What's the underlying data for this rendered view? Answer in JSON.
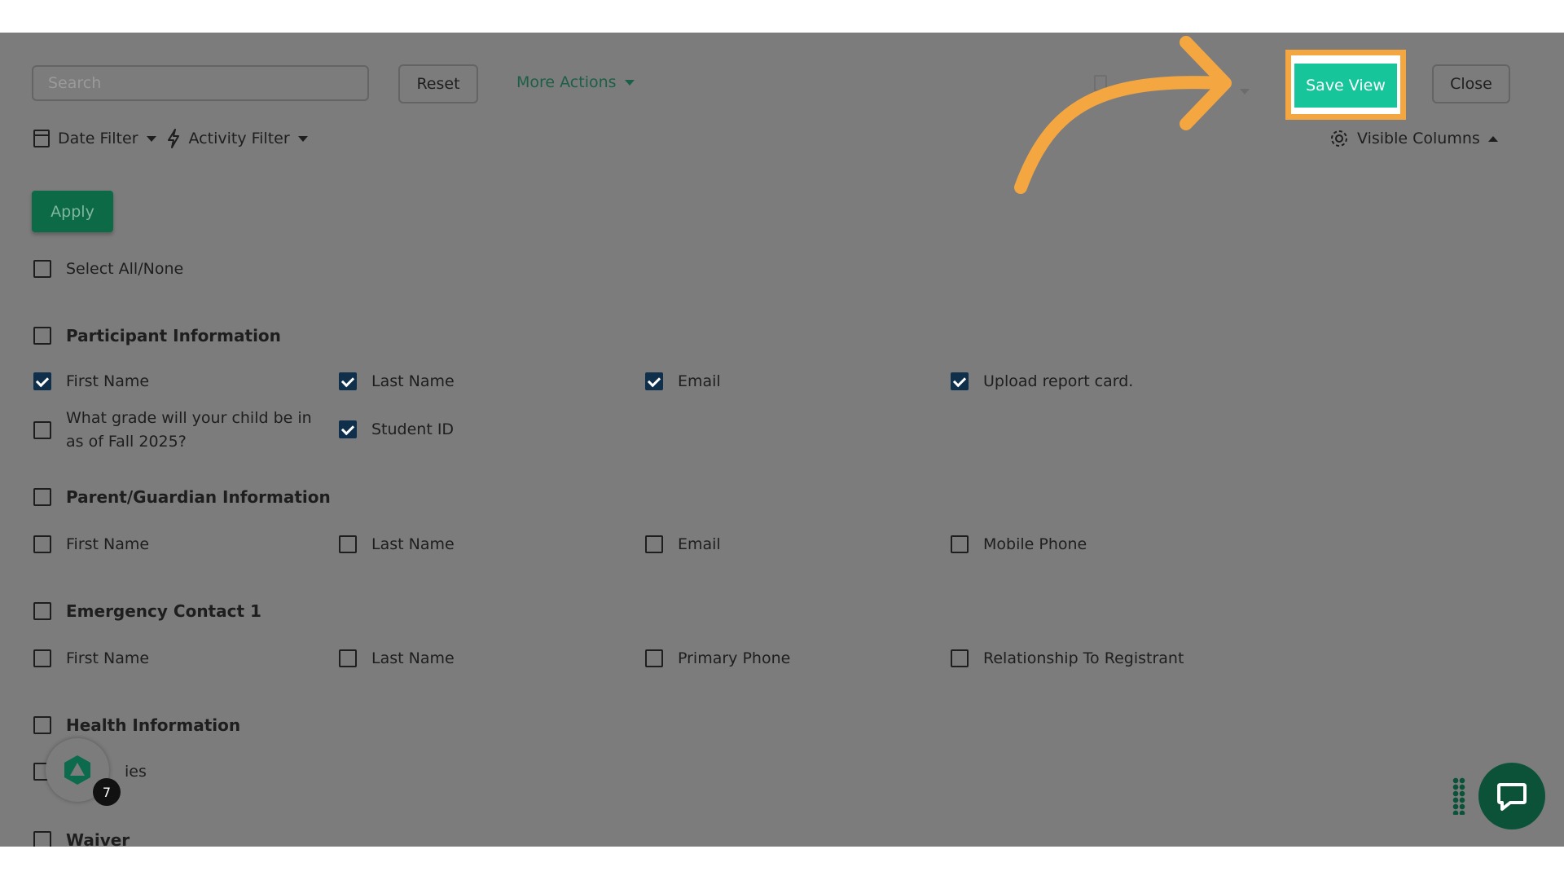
{
  "toolbar": {
    "search_placeholder": "Search",
    "reset_label": "Reset",
    "more_actions_label": "More Actions",
    "save_view_label": "Save View",
    "close_label": "Close"
  },
  "filters": {
    "date_filter_label": "Date Filter",
    "activity_filter_label": "Activity Filter",
    "visible_columns_label": "Visible Columns",
    "apply_label": "Apply"
  },
  "columns": {
    "select_all_label": "Select All/None",
    "sections": [
      {
        "title": "Participant Information",
        "checked": false,
        "fields": [
          {
            "label": "First Name",
            "checked": true
          },
          {
            "label": "Last Name",
            "checked": true
          },
          {
            "label": "Email",
            "checked": true
          },
          {
            "label": "Upload report card.",
            "checked": true
          },
          {
            "label": "What grade will your child be in as of Fall 2025?",
            "checked": false
          },
          {
            "label": "Student ID",
            "checked": true
          }
        ]
      },
      {
        "title": "Parent/Guardian Information",
        "checked": false,
        "fields": [
          {
            "label": "First Name",
            "checked": false
          },
          {
            "label": "Last Name",
            "checked": false
          },
          {
            "label": "Email",
            "checked": false
          },
          {
            "label": "Mobile Phone",
            "checked": false
          }
        ]
      },
      {
        "title": "Emergency Contact 1",
        "checked": false,
        "fields": [
          {
            "label": "First Name",
            "checked": false
          },
          {
            "label": "Last Name",
            "checked": false
          },
          {
            "label": "Primary Phone",
            "checked": false
          },
          {
            "label": "Relationship To Registrant",
            "checked": false
          }
        ]
      },
      {
        "title": "Health Information",
        "checked": false,
        "fields": [
          {
            "label": "ies",
            "checked": false
          }
        ]
      },
      {
        "title": "Waiver",
        "checked": false,
        "fields": []
      }
    ]
  },
  "widget": {
    "notification_count": "7"
  },
  "colors": {
    "overlay": "#7c7c7c",
    "highlight": "#f4a641",
    "save_button": "#17c59b",
    "apply_button": "#0d6a47",
    "checked_box": "#0f2f4a"
  }
}
